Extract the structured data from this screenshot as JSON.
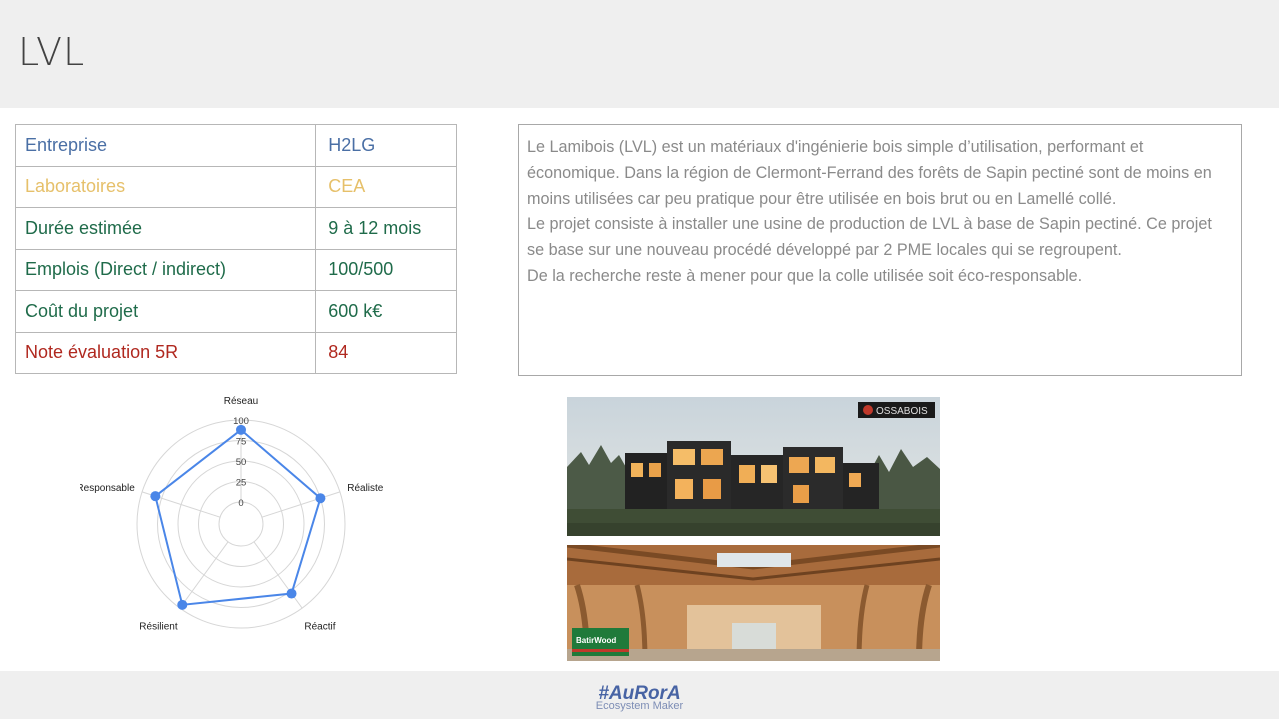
{
  "page": {
    "title": "LVL"
  },
  "info_rows": [
    {
      "label": "Entreprise",
      "value": "H2LG",
      "color": "#4a6fa5"
    },
    {
      "label": "Laboratoires",
      "value": "CEA",
      "color": "#e6c06a"
    },
    {
      "label": "Durée estimée",
      "value": "9 à 12 mois",
      "color": "#1f6b4a"
    },
    {
      "label": "Emplois (Direct / indirect)",
      "value": "100/500",
      "color": "#1f6b4a"
    },
    {
      "label": "Coût du projet",
      "value": "600 k€",
      "color": "#1f6b4a"
    },
    {
      "label": "Note évaluation 5R",
      "value": "84",
      "color": "#b0281f"
    }
  ],
  "description": {
    "paragraphs": [
      "Le Lamibois (LVL) est un matériaux d'ingénierie bois simple d’utilisation, performant et économique. Dans la région de Clermont-Ferrand des forêts de Sapin pectiné sont de moins en moins utilisées car peu pratique pour être utilisée en bois brut ou en Lamellé collé.",
      "Le projet consiste à installer une usine de production de LVL à base de Sapin pectiné. Ce projet se base sur une nouveau procédé développé par 2 PME locales qui se regroupent.",
      "De la recherche reste à mener pour que la colle utilisée soit éco-responsable."
    ]
  },
  "chart_data": {
    "type": "radar",
    "categories": [
      "Réseau",
      "Réaliste",
      "Réactif",
      "Résilient",
      "Responsable"
    ],
    "values": [
      88,
      75,
      78,
      95,
      83
    ],
    "rlim": [
      0,
      100
    ],
    "ticks": [
      "0",
      "25",
      "50",
      "75",
      "100"
    ],
    "series_color": "#4a86e8",
    "grid": true
  },
  "photos": {
    "photo1_logo": "OSSABOIS",
    "photo2_logo": "BatirWood"
  },
  "footer": {
    "brand": "#AuRorA",
    "tagline": "Ecosystem Maker"
  }
}
